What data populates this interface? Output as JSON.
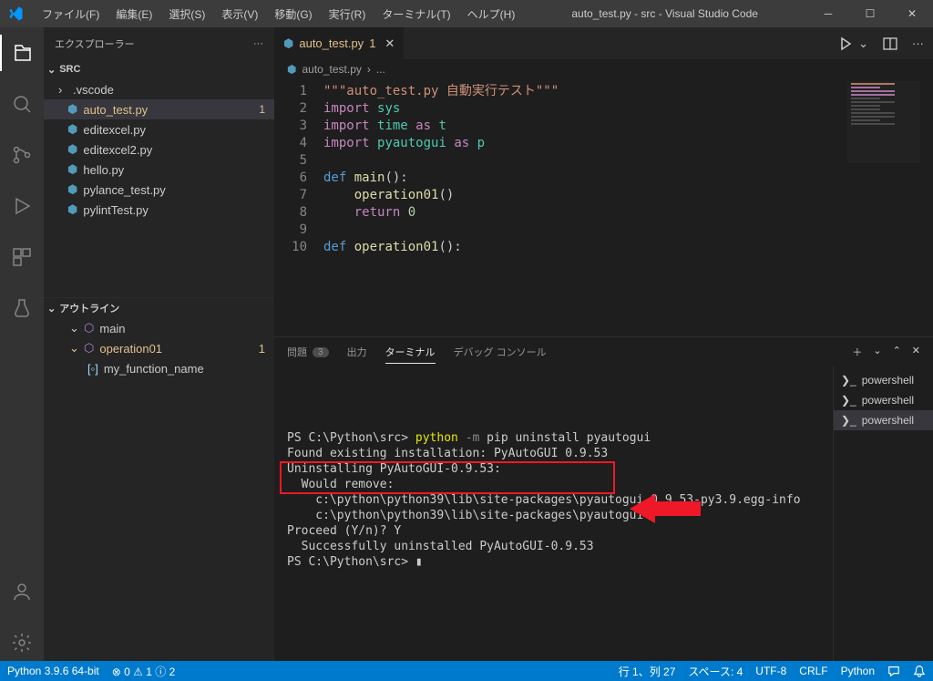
{
  "titlebar": {
    "menu": [
      "ファイル(F)",
      "編集(E)",
      "選択(S)",
      "表示(V)",
      "移動(G)",
      "実行(R)",
      "ターミナル(T)",
      "ヘルプ(H)"
    ],
    "title": "auto_test.py - src - Visual Studio Code"
  },
  "sidebar": {
    "title": "エクスプローラー",
    "root": "SRC",
    "files": [
      {
        "name": ".vscode",
        "type": "folder"
      },
      {
        "name": "auto_test.py",
        "type": "py",
        "selected": true,
        "badge": "1"
      },
      {
        "name": "editexcel.py",
        "type": "py"
      },
      {
        "name": "editexcel2.py",
        "type": "py"
      },
      {
        "name": "hello.py",
        "type": "py"
      },
      {
        "name": "pylance_test.py",
        "type": "py"
      },
      {
        "name": "pylintTest.py",
        "type": "py"
      }
    ],
    "outline_title": "アウトライン",
    "outline": [
      {
        "label": "main",
        "indent": 1,
        "icon": "cube"
      },
      {
        "label": "operation01",
        "indent": 1,
        "icon": "cube",
        "warn": true,
        "badge": "1"
      },
      {
        "label": "my_function_name",
        "indent": 2,
        "icon": "var"
      }
    ]
  },
  "editor": {
    "tab": {
      "name": "auto_test.py",
      "badge": "1"
    },
    "breadcrumb": [
      "auto_test.py",
      "..."
    ],
    "lines": [
      {
        "n": 1,
        "html": "<span class='tok-str'>\"\"\"auto_test.py 自動実行テスト\"\"\"</span>"
      },
      {
        "n": 2,
        "html": "<span class='tok-kw'>import</span> <span class='tok-mod'>sys</span>"
      },
      {
        "n": 3,
        "html": "<span class='tok-kw'>import</span> <span class='tok-mod'>time</span> <span class='tok-kw'>as</span> <span class='tok-mod'>t</span>"
      },
      {
        "n": 4,
        "html": "<span class='tok-kw'>import</span> <span class='tok-mod'>pyautogui</span> <span class='tok-kw'>as</span> <span class='tok-mod'>p</span>"
      },
      {
        "n": 5,
        "html": ""
      },
      {
        "n": 6,
        "html": "<span class='tok-def'>def</span> <span class='tok-fn'>main</span>():"
      },
      {
        "n": 7,
        "html": "    <span class='tok-fn'>operation01</span>()"
      },
      {
        "n": 8,
        "html": "    <span class='tok-kw'>return</span> <span class='tok-num'>0</span>"
      },
      {
        "n": 9,
        "html": ""
      },
      {
        "n": 10,
        "html": "<span class='tok-def'>def</span> <span class='tok-fn'>operation01</span>():"
      }
    ]
  },
  "panel": {
    "tabs": {
      "problems": "問題",
      "problems_count": "3",
      "output": "出力",
      "terminal": "ターミナル",
      "debug": "デバッグ コンソール"
    },
    "terminal_lines": [
      "PS C:\\Python\\src> <span class='term-yellow'>python</span> <span class='term-gray'>-m</span> pip uninstall pyautogui",
      "Found existing installation: PyAutoGUI 0.9.53",
      "Uninstalling PyAutoGUI-0.9.53:",
      "  Would remove:",
      "    c:\\python\\python39\\lib\\site-packages\\pyautogui-0.9.53-py3.9.egg-info",
      "    c:\\python\\python39\\lib\\site-packages\\pyautogui\\*",
      "Proceed (Y/n)? Y",
      "  Successfully uninstalled PyAutoGUI-0.9.53",
      "PS C:\\Python\\src> ▮"
    ],
    "sessions": [
      "powershell",
      "powershell",
      "powershell"
    ]
  },
  "statusbar": {
    "python": "Python 3.9.6 64-bit",
    "diag": "⊗ 0 ⚠ 1 ⓘ 2",
    "pos": "行 1、列 27",
    "spaces": "スペース: 4",
    "enc": "UTF-8",
    "eol": "CRLF",
    "lang": "Python"
  }
}
